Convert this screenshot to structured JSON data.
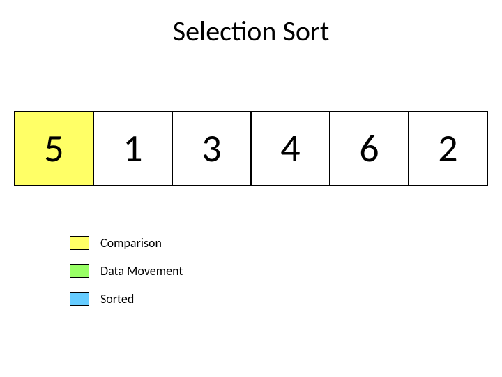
{
  "title": "Selection Sort",
  "cells": [
    {
      "value": "5",
      "state": "comparison"
    },
    {
      "value": "1",
      "state": "none"
    },
    {
      "value": "3",
      "state": "none"
    },
    {
      "value": "4",
      "state": "none"
    },
    {
      "value": "6",
      "state": "none"
    },
    {
      "value": "2",
      "state": "none"
    }
  ],
  "legend": {
    "comparison": "Comparison",
    "movement": "Data Movement",
    "sorted": "Sorted"
  },
  "colors": {
    "comparison": "#ffff66",
    "movement": "#99ff66",
    "sorted": "#66ccff"
  }
}
